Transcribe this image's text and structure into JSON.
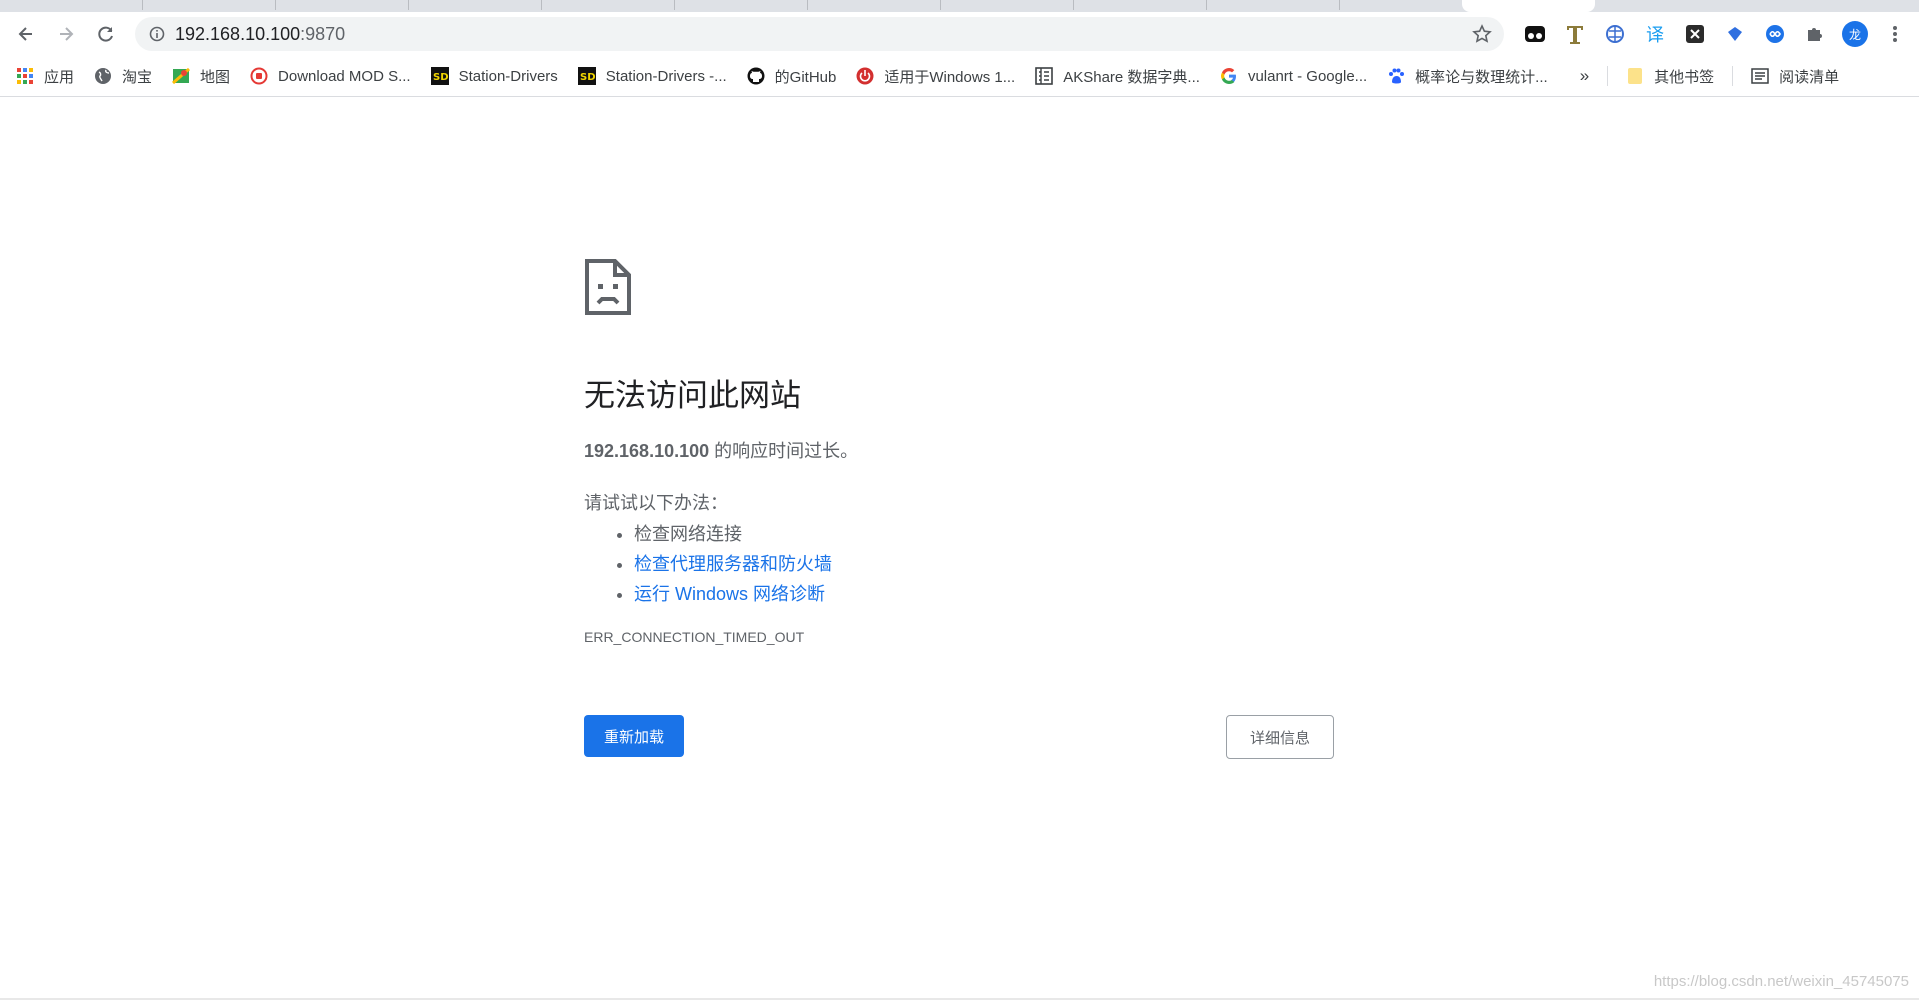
{
  "browser": {
    "url_host": "192.168.10.100",
    "url_port": ":9870",
    "profile_initial": "龙"
  },
  "bookmarks": [
    {
      "label": "应用",
      "icon": "apps-grid-icon"
    },
    {
      "label": "淘宝",
      "icon": "globe-icon"
    },
    {
      "label": "地图",
      "icon": "maps-icon"
    },
    {
      "label": "Download MOD S...",
      "icon": "red-circle-icon"
    },
    {
      "label": "Station-Drivers",
      "icon": "sd-icon"
    },
    {
      "label": "Station-Drivers -...",
      "icon": "sd-icon"
    },
    {
      "label": "的GitHub",
      "icon": "github-icon"
    },
    {
      "label": "适用于Windows 1...",
      "icon": "power-icon"
    },
    {
      "label": "AKShare 数据字典...",
      "icon": "book-icon"
    },
    {
      "label": "vulanrt - Google...",
      "icon": "google-icon"
    },
    {
      "label": "概率论与数理统计...",
      "icon": "baidu-icon"
    }
  ],
  "bookmarks_more": "»",
  "other_bookmarks": "其他书签",
  "reading_list": "阅读清单",
  "error": {
    "title": "无法访问此网站",
    "host": "192.168.10.100",
    "message": " 的响应时间过长。",
    "try_heading": "请试试以下办法：",
    "suggestions": [
      {
        "text": "检查网络连接",
        "link": false
      },
      {
        "text": "检查代理服务器和防火墙",
        "link": true
      },
      {
        "text": "运行 Windows 网络诊断",
        "link": true
      }
    ],
    "code": "ERR_CONNECTION_TIMED_OUT",
    "reload_label": "重新加载",
    "details_label": "详细信息"
  },
  "watermark": "https://blog.csdn.net/weixin_45745075",
  "colors": {
    "accent": "#1a73e8",
    "text_secondary": "#5f6368"
  }
}
